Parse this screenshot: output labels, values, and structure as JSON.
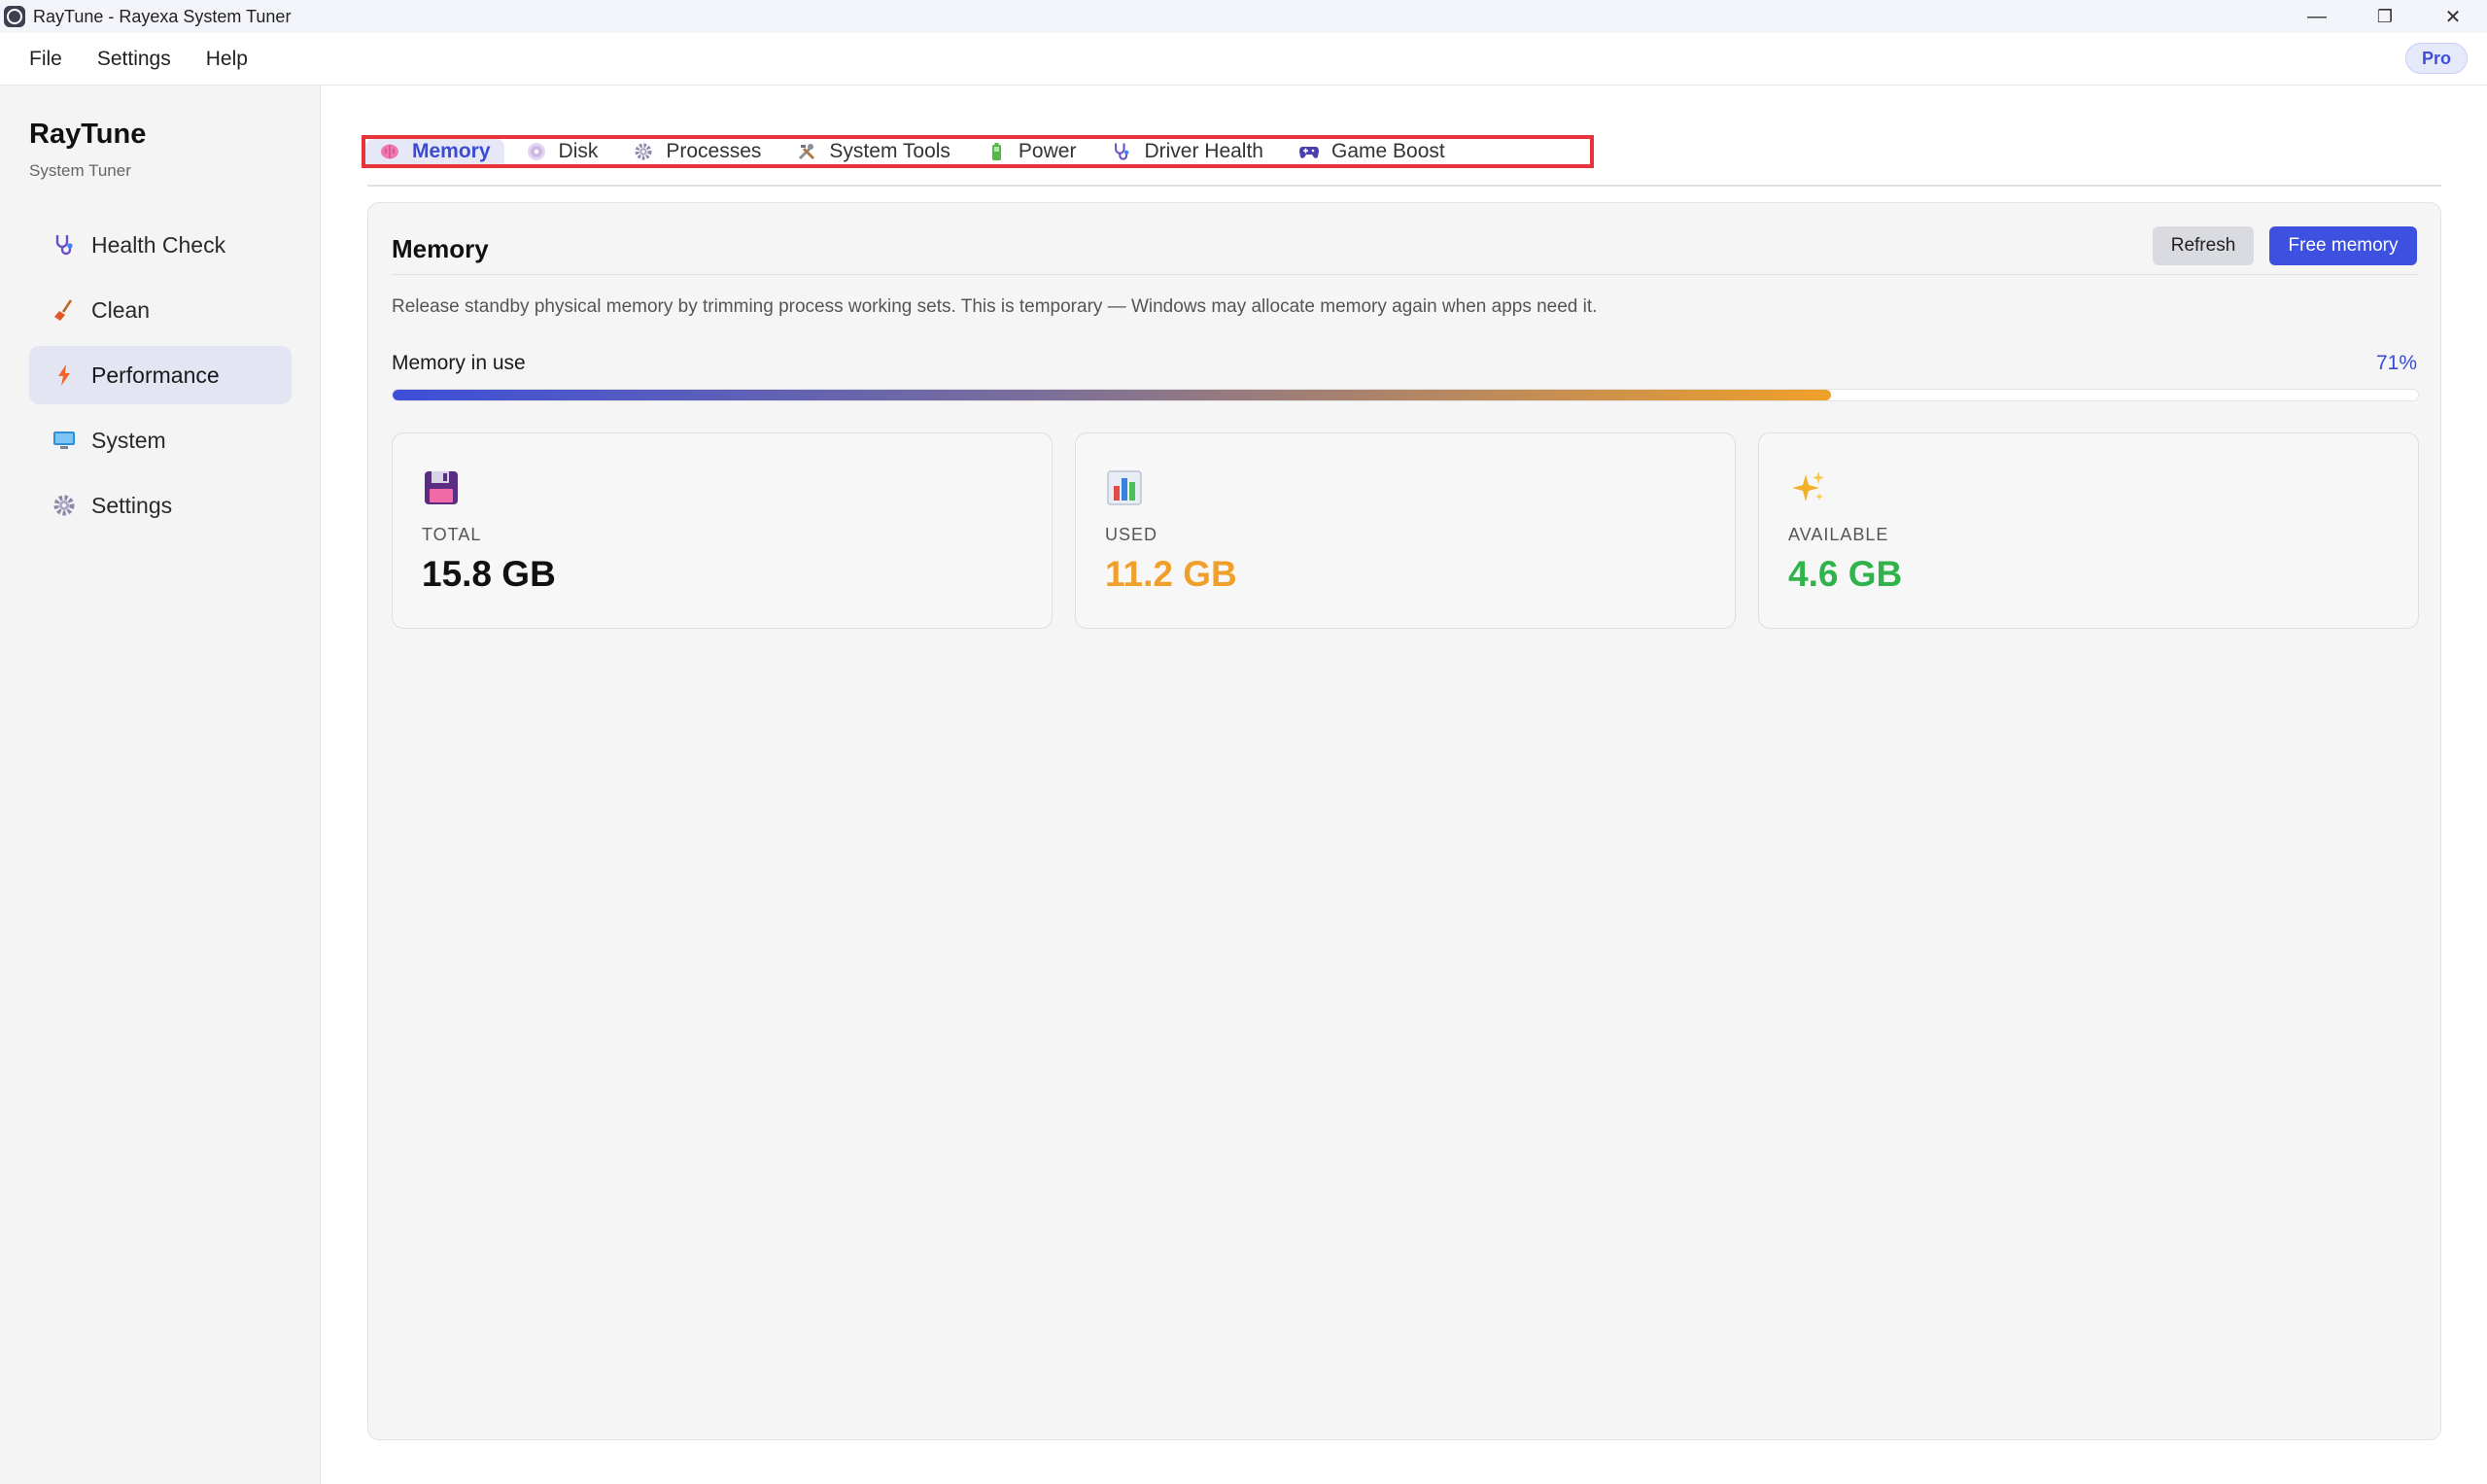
{
  "window": {
    "title": "RayTune - Rayexa System Tuner",
    "controls": {
      "minimize": "—",
      "restore": "❐",
      "close": "✕"
    }
  },
  "menu": [
    "File",
    "Settings",
    "Help"
  ],
  "badge": "Pro",
  "sidebar": {
    "title": "RayTune",
    "subtitle": "System Tuner",
    "items": [
      {
        "label": "Health Check",
        "icon": "stethoscope-icon"
      },
      {
        "label": "Clean",
        "icon": "broom-icon"
      },
      {
        "label": "Performance",
        "icon": "lightning-icon",
        "active": true
      },
      {
        "label": "System",
        "icon": "monitor-icon"
      },
      {
        "label": "Settings",
        "icon": "gear-icon"
      }
    ]
  },
  "tabs": [
    {
      "label": "Memory",
      "icon": "brain-icon",
      "active": true
    },
    {
      "label": "Disk",
      "icon": "disc-icon"
    },
    {
      "label": "Processes",
      "icon": "gear-icon"
    },
    {
      "label": "System Tools",
      "icon": "tools-icon"
    },
    {
      "label": "Power",
      "icon": "battery-icon"
    },
    {
      "label": "Driver Health",
      "icon": "stethoscope-icon"
    },
    {
      "label": "Game Boost",
      "icon": "gamepad-icon"
    }
  ],
  "memory": {
    "title": "Memory",
    "refresh_label": "Refresh",
    "free_label": "Free memory",
    "description": "Release standby physical memory by trimming process working sets. This is temporary — Windows may allocate memory again when apps need it.",
    "usage_label": "Memory in use",
    "usage_percent": 71,
    "usage_text": "71%",
    "stats": [
      {
        "label": "TOTAL",
        "value": "15.8 GB",
        "icon": "floppy-disk-icon",
        "color": "#111111"
      },
      {
        "label": "USED",
        "value": "11.2 GB",
        "icon": "bar-chart-icon",
        "color": "#f0a02a"
      },
      {
        "label": "AVAILABLE",
        "value": "4.6 GB",
        "icon": "sparkles-icon",
        "color": "#2fb34a"
      }
    ]
  },
  "colors": {
    "accent": "#3d50e0",
    "tab_highlight_border": "#e8333b",
    "used": "#f0a02a",
    "available": "#2fb34a"
  }
}
